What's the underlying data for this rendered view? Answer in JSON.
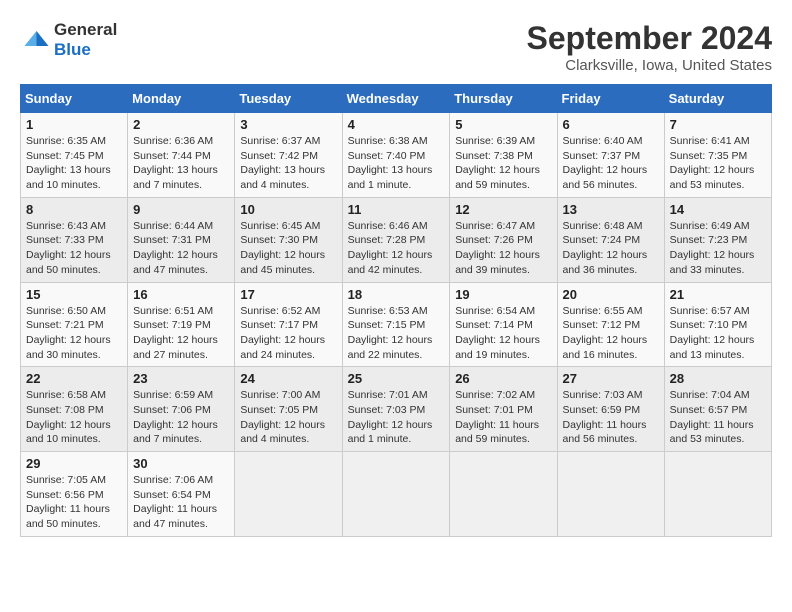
{
  "header": {
    "logo_line1": "General",
    "logo_line2": "Blue",
    "title": "September 2024",
    "subtitle": "Clarksville, Iowa, United States"
  },
  "days_of_week": [
    "Sunday",
    "Monday",
    "Tuesday",
    "Wednesday",
    "Thursday",
    "Friday",
    "Saturday"
  ],
  "weeks": [
    [
      {
        "day": "1",
        "info": "Sunrise: 6:35 AM\nSunset: 7:45 PM\nDaylight: 13 hours and 10 minutes."
      },
      {
        "day": "2",
        "info": "Sunrise: 6:36 AM\nSunset: 7:44 PM\nDaylight: 13 hours and 7 minutes."
      },
      {
        "day": "3",
        "info": "Sunrise: 6:37 AM\nSunset: 7:42 PM\nDaylight: 13 hours and 4 minutes."
      },
      {
        "day": "4",
        "info": "Sunrise: 6:38 AM\nSunset: 7:40 PM\nDaylight: 13 hours and 1 minute."
      },
      {
        "day": "5",
        "info": "Sunrise: 6:39 AM\nSunset: 7:38 PM\nDaylight: 12 hours and 59 minutes."
      },
      {
        "day": "6",
        "info": "Sunrise: 6:40 AM\nSunset: 7:37 PM\nDaylight: 12 hours and 56 minutes."
      },
      {
        "day": "7",
        "info": "Sunrise: 6:41 AM\nSunset: 7:35 PM\nDaylight: 12 hours and 53 minutes."
      }
    ],
    [
      {
        "day": "8",
        "info": "Sunrise: 6:43 AM\nSunset: 7:33 PM\nDaylight: 12 hours and 50 minutes."
      },
      {
        "day": "9",
        "info": "Sunrise: 6:44 AM\nSunset: 7:31 PM\nDaylight: 12 hours and 47 minutes."
      },
      {
        "day": "10",
        "info": "Sunrise: 6:45 AM\nSunset: 7:30 PM\nDaylight: 12 hours and 45 minutes."
      },
      {
        "day": "11",
        "info": "Sunrise: 6:46 AM\nSunset: 7:28 PM\nDaylight: 12 hours and 42 minutes."
      },
      {
        "day": "12",
        "info": "Sunrise: 6:47 AM\nSunset: 7:26 PM\nDaylight: 12 hours and 39 minutes."
      },
      {
        "day": "13",
        "info": "Sunrise: 6:48 AM\nSunset: 7:24 PM\nDaylight: 12 hours and 36 minutes."
      },
      {
        "day": "14",
        "info": "Sunrise: 6:49 AM\nSunset: 7:23 PM\nDaylight: 12 hours and 33 minutes."
      }
    ],
    [
      {
        "day": "15",
        "info": "Sunrise: 6:50 AM\nSunset: 7:21 PM\nDaylight: 12 hours and 30 minutes."
      },
      {
        "day": "16",
        "info": "Sunrise: 6:51 AM\nSunset: 7:19 PM\nDaylight: 12 hours and 27 minutes."
      },
      {
        "day": "17",
        "info": "Sunrise: 6:52 AM\nSunset: 7:17 PM\nDaylight: 12 hours and 24 minutes."
      },
      {
        "day": "18",
        "info": "Sunrise: 6:53 AM\nSunset: 7:15 PM\nDaylight: 12 hours and 22 minutes."
      },
      {
        "day": "19",
        "info": "Sunrise: 6:54 AM\nSunset: 7:14 PM\nDaylight: 12 hours and 19 minutes."
      },
      {
        "day": "20",
        "info": "Sunrise: 6:55 AM\nSunset: 7:12 PM\nDaylight: 12 hours and 16 minutes."
      },
      {
        "day": "21",
        "info": "Sunrise: 6:57 AM\nSunset: 7:10 PM\nDaylight: 12 hours and 13 minutes."
      }
    ],
    [
      {
        "day": "22",
        "info": "Sunrise: 6:58 AM\nSunset: 7:08 PM\nDaylight: 12 hours and 10 minutes."
      },
      {
        "day": "23",
        "info": "Sunrise: 6:59 AM\nSunset: 7:06 PM\nDaylight: 12 hours and 7 minutes."
      },
      {
        "day": "24",
        "info": "Sunrise: 7:00 AM\nSunset: 7:05 PM\nDaylight: 12 hours and 4 minutes."
      },
      {
        "day": "25",
        "info": "Sunrise: 7:01 AM\nSunset: 7:03 PM\nDaylight: 12 hours and 1 minute."
      },
      {
        "day": "26",
        "info": "Sunrise: 7:02 AM\nSunset: 7:01 PM\nDaylight: 11 hours and 59 minutes."
      },
      {
        "day": "27",
        "info": "Sunrise: 7:03 AM\nSunset: 6:59 PM\nDaylight: 11 hours and 56 minutes."
      },
      {
        "day": "28",
        "info": "Sunrise: 7:04 AM\nSunset: 6:57 PM\nDaylight: 11 hours and 53 minutes."
      }
    ],
    [
      {
        "day": "29",
        "info": "Sunrise: 7:05 AM\nSunset: 6:56 PM\nDaylight: 11 hours and 50 minutes."
      },
      {
        "day": "30",
        "info": "Sunrise: 7:06 AM\nSunset: 6:54 PM\nDaylight: 11 hours and 47 minutes."
      },
      null,
      null,
      null,
      null,
      null
    ]
  ]
}
